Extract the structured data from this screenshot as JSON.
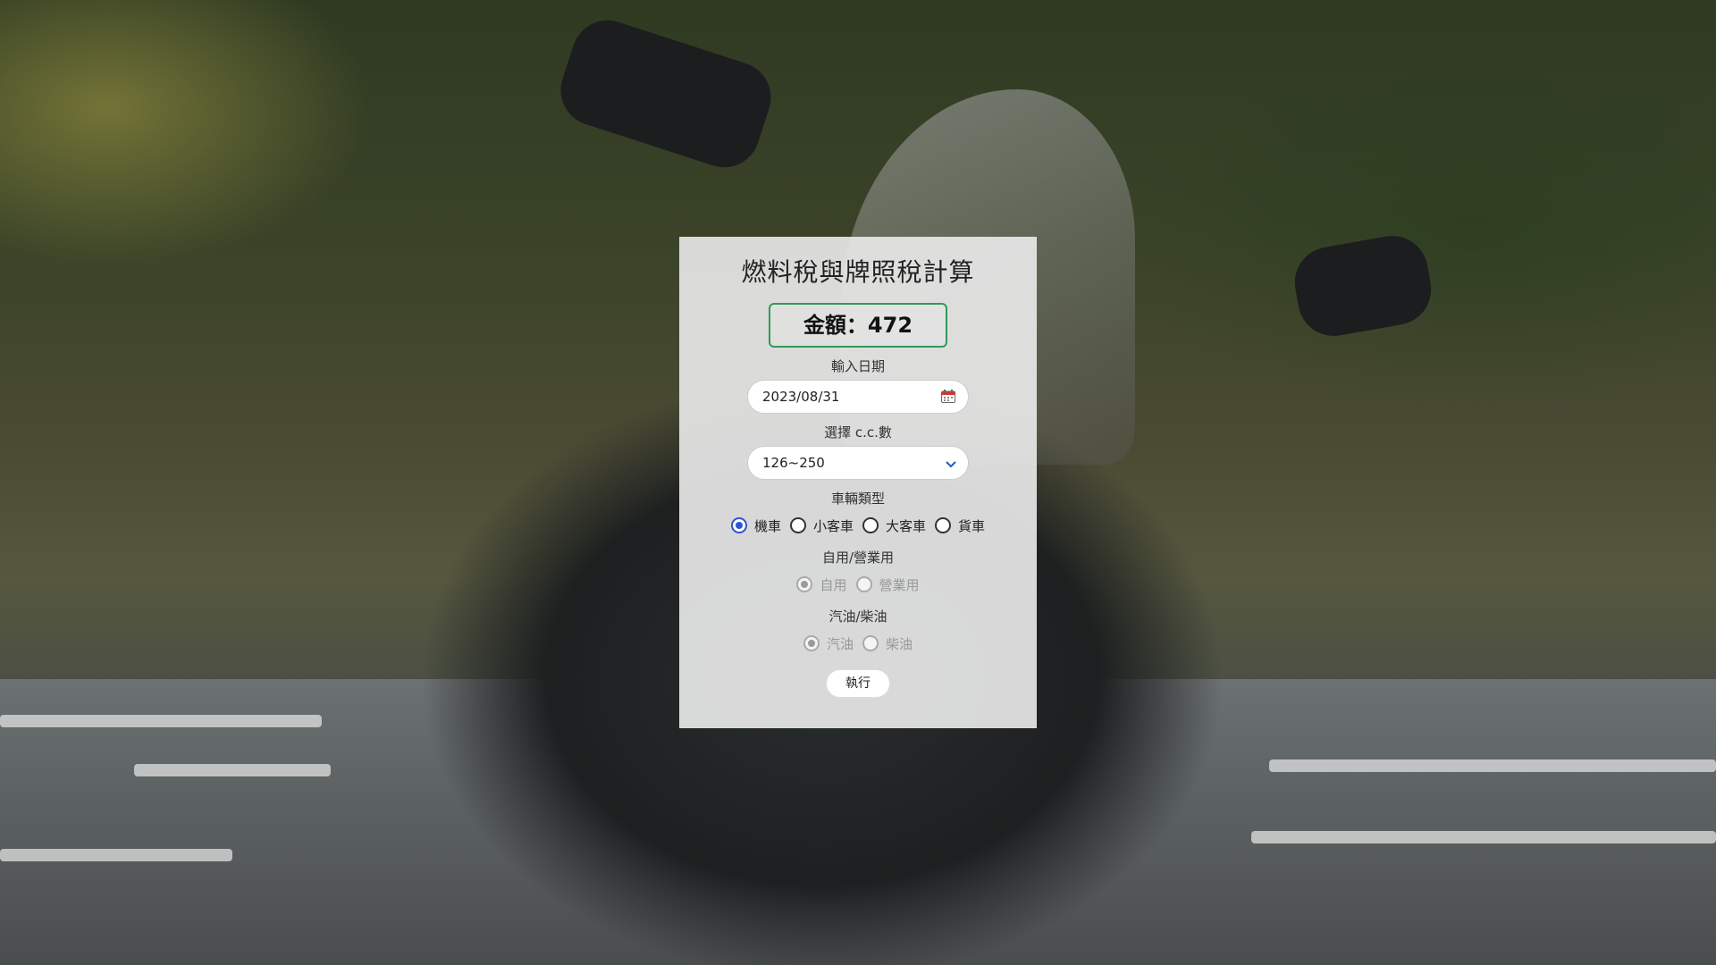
{
  "form": {
    "title": "燃料稅與牌照稅計算",
    "amount_text": "金額：472",
    "date_label": "輸入日期",
    "date_value": "2023/08/31",
    "cc_label": "選擇 c.c.數",
    "cc_value": "126~250",
    "vehicle_type_label": "車輛類型",
    "vehicle_types": [
      {
        "label": "機車",
        "checked": true
      },
      {
        "label": "小客車",
        "checked": false
      },
      {
        "label": "大客車",
        "checked": false
      },
      {
        "label": "貨車",
        "checked": false
      }
    ],
    "usage_label": "自用/營業用",
    "usage_options": [
      {
        "label": "自用",
        "checked": true,
        "disabled": true
      },
      {
        "label": "營業用",
        "checked": false,
        "disabled": true
      }
    ],
    "fuel_label": "汽油/柴油",
    "fuel_options": [
      {
        "label": "汽油",
        "checked": true,
        "disabled": true
      },
      {
        "label": "柴油",
        "checked": false,
        "disabled": true
      }
    ],
    "execute_label": "執行"
  },
  "colors": {
    "accent": "#2d55d0",
    "amount_border": "#2f9a5a",
    "card_bg": "#e8e8e8"
  },
  "icons": {
    "date": "calendar-icon",
    "select": "chevron-down-icon"
  }
}
